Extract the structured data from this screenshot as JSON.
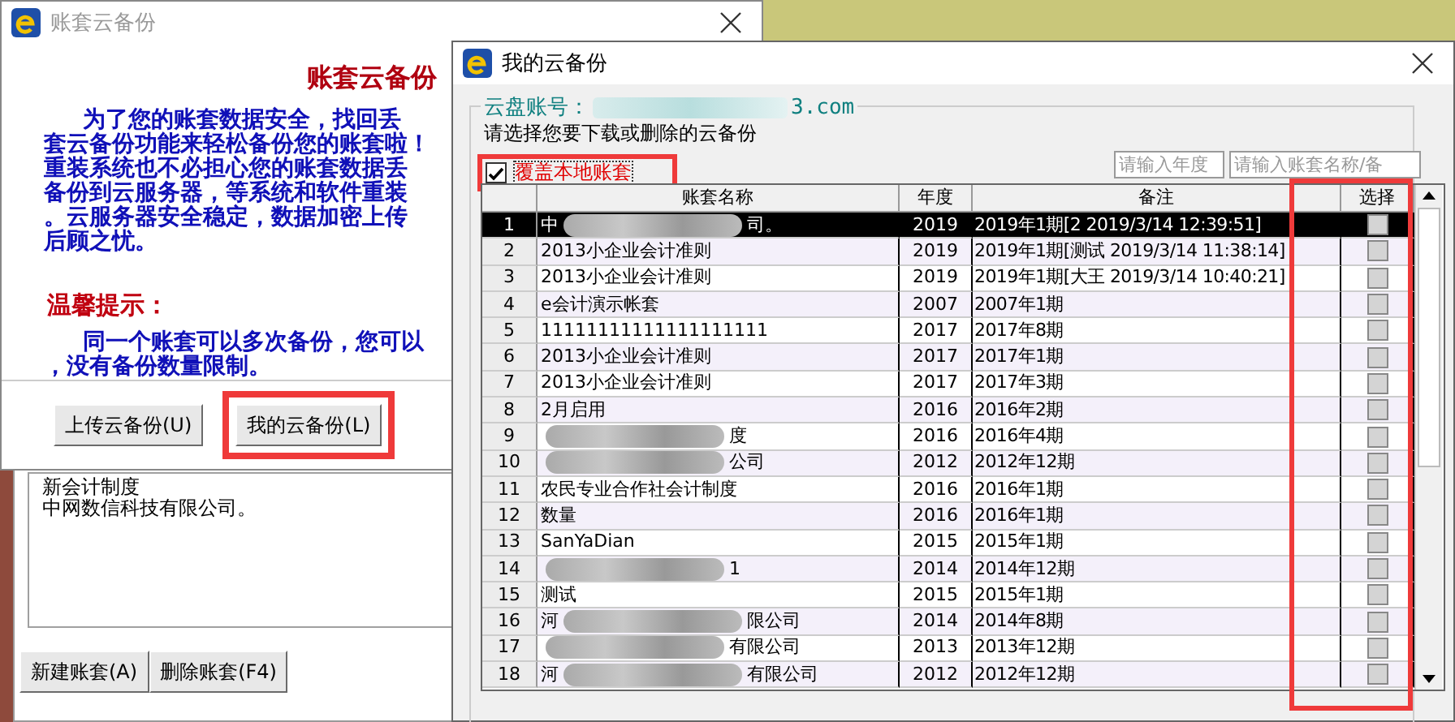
{
  "back_window": {
    "lines": [
      "新会计制度",
      "中网数信科技有限公司。"
    ],
    "buttons": [
      "新建账套(A)",
      "删除账套(F4)"
    ]
  },
  "cloud_dialog": {
    "title": "账套云备份",
    "heading": "账套云备份",
    "paragraph": [
      "为了您的账套数据安全，找回丢",
      "套云备份功能来轻松备份您的账套啦！",
      "重装系统也不必担心您的账套数据丢",
      "备份到云服务器，等系统和软件重装",
      "。云服务器安全稳定，数据加密上传",
      "后顾之忧。"
    ],
    "tip_title": "温馨提示：",
    "tip": [
      "同一个账套可以多次备份，您可以",
      "，没有备份数量限制。"
    ],
    "buttons": [
      {
        "label": "上传云备份(U)",
        "highlighted": false
      },
      {
        "label": "我的云备份(L)",
        "highlighted": true
      }
    ]
  },
  "my_backups": {
    "title": "我的云备份",
    "account_label": "云盘账号：",
    "account_end": "3.com",
    "instruction": "请选择您要下载或删除的云备份",
    "overwrite": {
      "label": "覆盖本地账套",
      "checked": true
    },
    "year_search": {
      "placeholder": "请输入年度"
    },
    "name_search": {
      "placeholder": "请输入账套名称/备"
    },
    "columns": [
      "账套名称",
      "年度",
      "备注",
      "选择"
    ],
    "rows": [
      {
        "num": "1",
        "name": "中",
        "name_end": "司。",
        "redacted": true,
        "year": "2019",
        "note": "2019年1期[2 2019/3/14 12:39:51]",
        "selected": true,
        "checked": false
      },
      {
        "num": "2",
        "name": "2013小企业会计准则",
        "redacted": false,
        "year": "2019",
        "note": "2019年1期[测试 2019/3/14 11:38:14]",
        "selected": false,
        "checked": false
      },
      {
        "num": "3",
        "name": "2013小企业会计准则",
        "redacted": false,
        "year": "2019",
        "note": "2019年1期[大王 2019/3/14 10:40:21]",
        "selected": false,
        "checked": false
      },
      {
        "num": "4",
        "name": "e会计演示帐套",
        "redacted": false,
        "year": "2007",
        "note": "2007年1期",
        "selected": false,
        "checked": false
      },
      {
        "num": "5",
        "name": "11111111111111111111",
        "redacted": false,
        "year": "2017",
        "note": "2017年8期",
        "selected": false,
        "checked": false
      },
      {
        "num": "6",
        "name": "2013小企业会计准则",
        "redacted": false,
        "year": "2017",
        "note": "2017年1期",
        "selected": false,
        "checked": false
      },
      {
        "num": "7",
        "name": "2013小企业会计准则",
        "redacted": false,
        "year": "2017",
        "note": "2017年3期",
        "selected": false,
        "checked": false
      },
      {
        "num": "8",
        "name": "2月启用",
        "redacted": false,
        "year": "2016",
        "note": "2016年2期",
        "selected": false,
        "checked": false
      },
      {
        "num": "9",
        "name_end": "度",
        "redacted": true,
        "year": "2016",
        "note": "2016年4期",
        "selected": false,
        "checked": false
      },
      {
        "num": "10",
        "name_end": "公司",
        "redacted": true,
        "year": "2012",
        "note": "2012年12期",
        "selected": false,
        "checked": false
      },
      {
        "num": "11",
        "name": "农民专业合作社会计制度",
        "redacted": false,
        "year": "2016",
        "note": "2016年1期",
        "selected": false,
        "checked": false
      },
      {
        "num": "12",
        "name": "数量",
        "redacted": false,
        "year": "2016",
        "note": "2016年1期",
        "selected": false,
        "checked": false
      },
      {
        "num": "13",
        "name": "SanYaDian",
        "redacted": false,
        "year": "2015",
        "note": "2015年1期",
        "selected": false,
        "checked": false
      },
      {
        "num": "14",
        "name_end": "1",
        "redacted": true,
        "year": "2014",
        "note": "2014年12期",
        "selected": false,
        "checked": false
      },
      {
        "num": "15",
        "name": "测试",
        "redacted": false,
        "year": "2015",
        "note": "2015年1期",
        "selected": false,
        "checked": false
      },
      {
        "num": "16",
        "name": "河",
        "name_end": "限公司",
        "redacted": true,
        "year": "2014",
        "note": "2014年8期",
        "selected": false,
        "checked": false
      },
      {
        "num": "17",
        "name_end": "有限公司",
        "redacted": true,
        "year": "2013",
        "note": "2013年12期",
        "selected": false,
        "checked": false
      },
      {
        "num": "18",
        "name": "河",
        "name_end": "有限公司",
        "redacted": true,
        "year": "2012",
        "note": "2012年12期",
        "selected": false,
        "checked": false
      }
    ]
  }
}
